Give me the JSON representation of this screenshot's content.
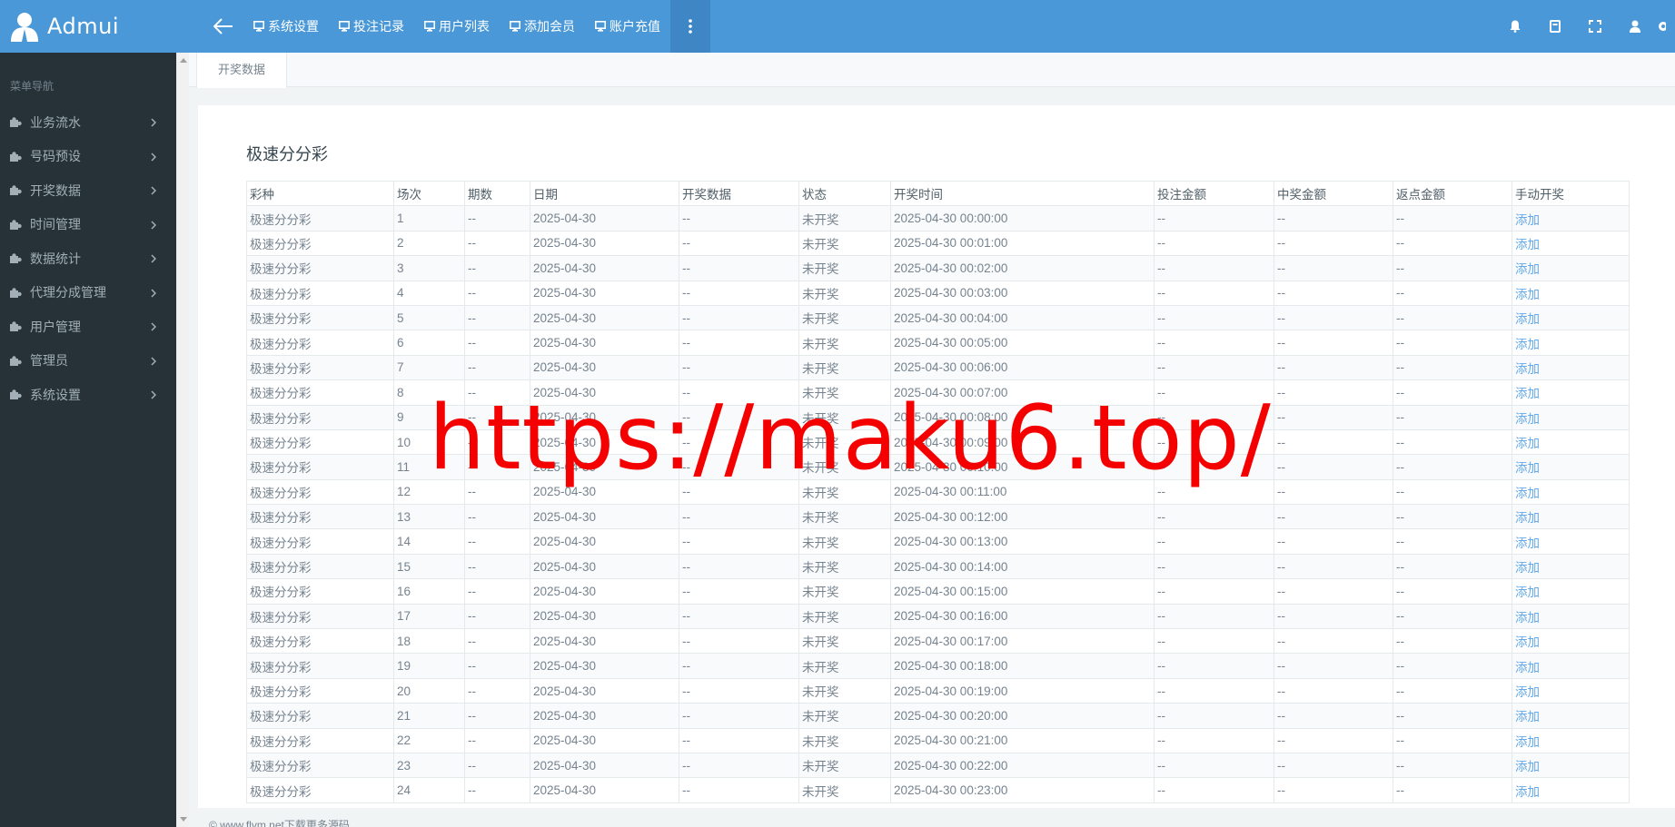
{
  "brand": {
    "name": "Admui"
  },
  "nav": {
    "items": [
      {
        "label": "系统设置"
      },
      {
        "label": "投注记录"
      },
      {
        "label": "用户列表"
      },
      {
        "label": "添加会员"
      },
      {
        "label": "账户充值"
      }
    ]
  },
  "sidebar": {
    "title": "菜单导航",
    "items": [
      {
        "label": "业务流水"
      },
      {
        "label": "号码预设"
      },
      {
        "label": "开奖数据"
      },
      {
        "label": "时间管理"
      },
      {
        "label": "数据统计"
      },
      {
        "label": "代理分成管理"
      },
      {
        "label": "用户管理"
      },
      {
        "label": "管理员"
      },
      {
        "label": "系统设置"
      }
    ]
  },
  "tabs": [
    {
      "label": "开奖数据"
    }
  ],
  "panel": {
    "title": "极速分分彩"
  },
  "table": {
    "columns": [
      "彩种",
      "场次",
      "期数",
      "日期",
      "开奖数据",
      "状态",
      "开奖时间",
      "投注金额",
      "中奖金额",
      "返点金额",
      "手动开奖"
    ],
    "rows": [
      [
        "极速分分彩",
        "1",
        "--",
        "2025-04-30",
        "--",
        "未开奖",
        "2025-04-30 00:00:00",
        "--",
        "--",
        "--",
        "添加"
      ],
      [
        "极速分分彩",
        "2",
        "--",
        "2025-04-30",
        "--",
        "未开奖",
        "2025-04-30 00:01:00",
        "--",
        "--",
        "--",
        "添加"
      ],
      [
        "极速分分彩",
        "3",
        "--",
        "2025-04-30",
        "--",
        "未开奖",
        "2025-04-30 00:02:00",
        "--",
        "--",
        "--",
        "添加"
      ],
      [
        "极速分分彩",
        "4",
        "--",
        "2025-04-30",
        "--",
        "未开奖",
        "2025-04-30 00:03:00",
        "--",
        "--",
        "--",
        "添加"
      ],
      [
        "极速分分彩",
        "5",
        "--",
        "2025-04-30",
        "--",
        "未开奖",
        "2025-04-30 00:04:00",
        "--",
        "--",
        "--",
        "添加"
      ],
      [
        "极速分分彩",
        "6",
        "--",
        "2025-04-30",
        "--",
        "未开奖",
        "2025-04-30 00:05:00",
        "--",
        "--",
        "--",
        "添加"
      ],
      [
        "极速分分彩",
        "7",
        "--",
        "2025-04-30",
        "--",
        "未开奖",
        "2025-04-30 00:06:00",
        "--",
        "--",
        "--",
        "添加"
      ],
      [
        "极速分分彩",
        "8",
        "--",
        "2025-04-30",
        "--",
        "未开奖",
        "2025-04-30 00:07:00",
        "--",
        "--",
        "--",
        "添加"
      ],
      [
        "极速分分彩",
        "9",
        "--",
        "2025-04-30",
        "--",
        "未开奖",
        "2025-04-30 00:08:00",
        "--",
        "--",
        "--",
        "添加"
      ],
      [
        "极速分分彩",
        "10",
        "--",
        "2025-04-30",
        "--",
        "未开奖",
        "2025-04-30 00:09:00",
        "--",
        "--",
        "--",
        "添加"
      ],
      [
        "极速分分彩",
        "11",
        "--",
        "2025-04-30",
        "--",
        "未开奖",
        "2025-04-30 00:10:00",
        "--",
        "--",
        "--",
        "添加"
      ],
      [
        "极速分分彩",
        "12",
        "--",
        "2025-04-30",
        "--",
        "未开奖",
        "2025-04-30 00:11:00",
        "--",
        "--",
        "--",
        "添加"
      ],
      [
        "极速分分彩",
        "13",
        "--",
        "2025-04-30",
        "--",
        "未开奖",
        "2025-04-30 00:12:00",
        "--",
        "--",
        "--",
        "添加"
      ],
      [
        "极速分分彩",
        "14",
        "--",
        "2025-04-30",
        "--",
        "未开奖",
        "2025-04-30 00:13:00",
        "--",
        "--",
        "--",
        "添加"
      ],
      [
        "极速分分彩",
        "15",
        "--",
        "2025-04-30",
        "--",
        "未开奖",
        "2025-04-30 00:14:00",
        "--",
        "--",
        "--",
        "添加"
      ],
      [
        "极速分分彩",
        "16",
        "--",
        "2025-04-30",
        "--",
        "未开奖",
        "2025-04-30 00:15:00",
        "--",
        "--",
        "--",
        "添加"
      ],
      [
        "极速分分彩",
        "17",
        "--",
        "2025-04-30",
        "--",
        "未开奖",
        "2025-04-30 00:16:00",
        "--",
        "--",
        "--",
        "添加"
      ],
      [
        "极速分分彩",
        "18",
        "--",
        "2025-04-30",
        "--",
        "未开奖",
        "2025-04-30 00:17:00",
        "--",
        "--",
        "--",
        "添加"
      ],
      [
        "极速分分彩",
        "19",
        "--",
        "2025-04-30",
        "--",
        "未开奖",
        "2025-04-30 00:18:00",
        "--",
        "--",
        "--",
        "添加"
      ],
      [
        "极速分分彩",
        "20",
        "--",
        "2025-04-30",
        "--",
        "未开奖",
        "2025-04-30 00:19:00",
        "--",
        "--",
        "--",
        "添加"
      ],
      [
        "极速分分彩",
        "21",
        "--",
        "2025-04-30",
        "--",
        "未开奖",
        "2025-04-30 00:20:00",
        "--",
        "--",
        "--",
        "添加"
      ],
      [
        "极速分分彩",
        "22",
        "--",
        "2025-04-30",
        "--",
        "未开奖",
        "2025-04-30 00:21:00",
        "--",
        "--",
        "--",
        "添加"
      ],
      [
        "极速分分彩",
        "23",
        "--",
        "2025-04-30",
        "--",
        "未开奖",
        "2025-04-30 00:22:00",
        "--",
        "--",
        "--",
        "添加"
      ],
      [
        "极速分分彩",
        "24",
        "--",
        "2025-04-30",
        "--",
        "未开奖",
        "2025-04-30 00:23:00",
        "--",
        "--",
        "--",
        "添加"
      ]
    ]
  },
  "footer": {
    "text": "© www.flvm.net下载更多源码"
  },
  "watermark": {
    "text": "https://maku6.top/"
  },
  "colors": {
    "navbar": "#4a98d7",
    "sidebar": "#263238",
    "link": "#62a8ea",
    "watermark": "#f50000"
  },
  "icons": [
    "user-icon",
    "arrow-left-icon",
    "monitor-icon",
    "more-vertical-icon",
    "bell-icon",
    "bookmark-icon",
    "fullscreen-icon",
    "account-icon",
    "puzzle-icon",
    "chevron-right-icon"
  ]
}
